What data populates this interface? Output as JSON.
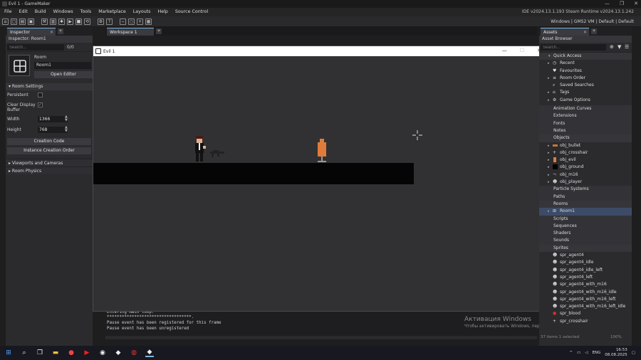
{
  "titlebar": {
    "title": "Evil 1 - GameMaker",
    "controls": [
      "—",
      "❐",
      "✕"
    ]
  },
  "menubar": {
    "items": [
      "File",
      "Edit",
      "Build",
      "Windows",
      "Tools",
      "Marketplace",
      "Layouts",
      "Help",
      "Source Control"
    ],
    "version": "IDE v2024.13.1.193 Steam  Runtime v2024.13.1.242"
  },
  "toolbar": {
    "target": "Windows | GMS2 VM | Default | Default"
  },
  "inspector": {
    "tab": "Inspector",
    "header": "Inspector: Room1",
    "search_placeholder": "Search...",
    "count": "0/0",
    "room_label": "Room",
    "room_name": "Room1",
    "open_editor": "Open Editor",
    "settings_section": "Room Settings",
    "persistent_label": "Persistent",
    "clear_display_label": "Clear Display Buffer",
    "clear_display_checked": "✓",
    "width_label": "Width",
    "width_value": "1366",
    "height_label": "Height",
    "height_value": "768",
    "creation_code": "Creation Code",
    "instance_order": "Instance Creation Order",
    "viewports": "Viewports and Cameras",
    "physics": "Room Physics"
  },
  "workspace": {
    "tab": "Workspace 1"
  },
  "game_window": {
    "title": "Evil 1",
    "controls": [
      "—",
      "☐",
      "✕"
    ]
  },
  "console": {
    "lines": [
      "Entering main loop.",
      "**********************************.",
      "Pause event has been registered for this frame",
      "Pause event has been unregistered"
    ]
  },
  "activation": {
    "title": "Активация Windows",
    "subtitle": "Чтобы активировать Windows, перейдите в раздел \"Параметры\"."
  },
  "assets": {
    "tab": "Assets",
    "header": "Asset Browser",
    "search_placeholder": "Search...",
    "quick_access": "Quick Access",
    "quick_items": [
      "Recent",
      "Favourites",
      "Room Order",
      "Saved Searches",
      "Tags",
      "Game Options"
    ],
    "groups_top": [
      "Animation Curves",
      "Extensions",
      "Fonts",
      "Notes"
    ],
    "objects_label": "Objects",
    "objects": [
      "obj_bullet",
      "obj_crosshair",
      "obj_evil",
      "obj_ground",
      "obj_m16",
      "obj_player"
    ],
    "groups_mid": [
      "Particle Systems",
      "Paths"
    ],
    "rooms_label": "Rooms",
    "rooms": [
      "Room1"
    ],
    "groups_after": [
      "Scripts",
      "Sequences",
      "Shaders",
      "Sounds"
    ],
    "sprites_label": "Sprites",
    "sprites": [
      "spr_agent4",
      "spr_agent4_idle",
      "spr_agent4_idle_left",
      "spr_agent4_left",
      "spr_agent4_with_m16",
      "spr_agent4_with_m16_idle",
      "spr_agent4_with_m16_left",
      "spr_agent4_with_m16_left_idle",
      "spr_blood",
      "spr_crosshair"
    ],
    "status": "37 items    1 selected",
    "zoom": "100%"
  },
  "taskbar": {
    "lang": "ENG",
    "time": "16:53",
    "date": "08.08.2025"
  },
  "colors": {
    "accent": "#7cb4e0",
    "selected": "#3d4b66",
    "game_bg": "#313134",
    "ground": "#050505",
    "target": "#e07c3a"
  }
}
